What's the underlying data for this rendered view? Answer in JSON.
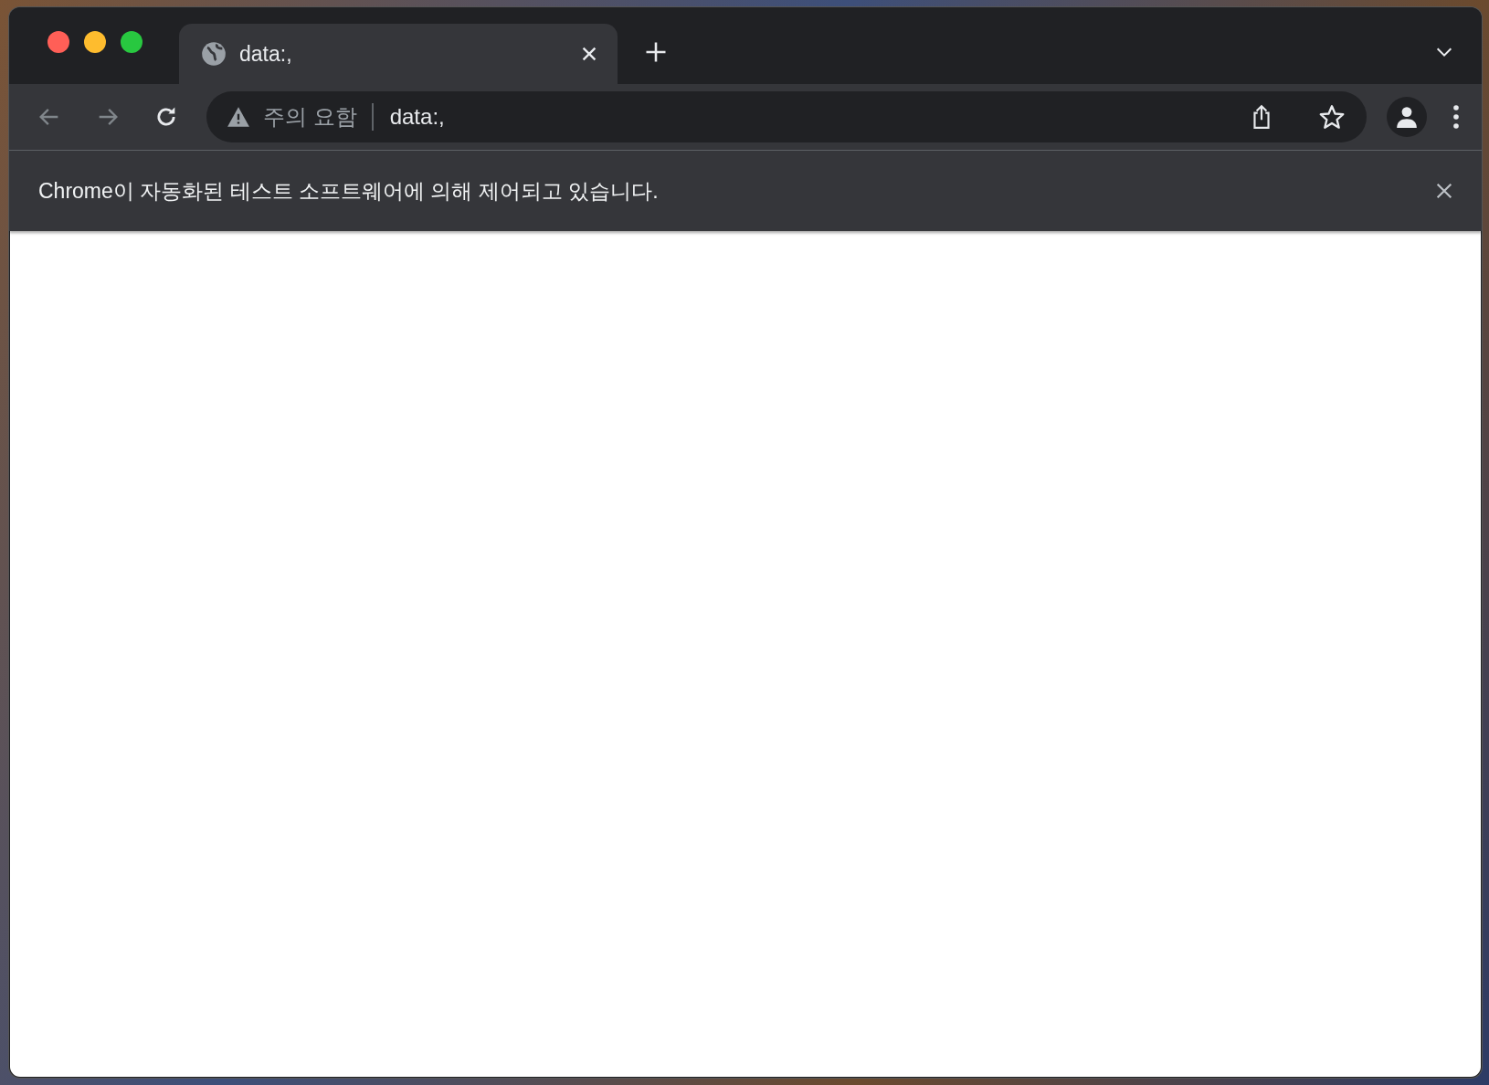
{
  "window": {
    "tabs": [
      {
        "title": "data:,",
        "selected": true
      }
    ],
    "nav_buttons": [
      {
        "kind": "back",
        "disabled": true
      },
      {
        "kind": "forward",
        "disabled": true
      },
      {
        "kind": "reload",
        "disabled": false
      }
    ],
    "address_bar": {
      "security_label": "주의 요함",
      "url": "data:,"
    },
    "infobar": {
      "message": "Chrome이 자동화된 테스트 소프트웨어에 의해 제어되고 있습니다."
    }
  }
}
